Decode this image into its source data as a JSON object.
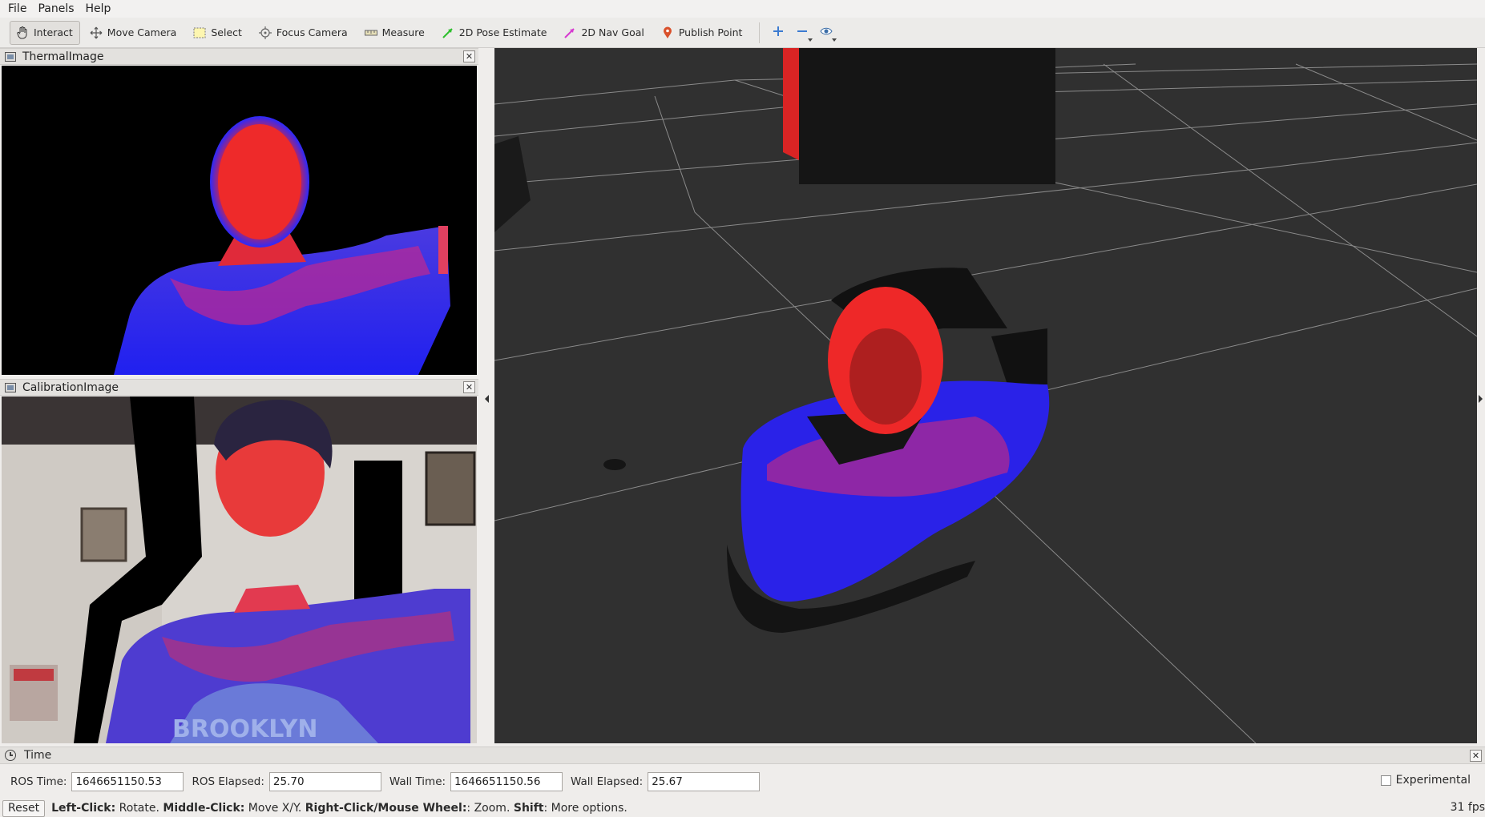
{
  "menubar": {
    "items": [
      {
        "label": "File"
      },
      {
        "label": "Panels"
      },
      {
        "label": "Help"
      }
    ]
  },
  "toolbar": {
    "tools": [
      {
        "label": "Interact",
        "icon": "hand-icon",
        "active": true
      },
      {
        "label": "Move Camera",
        "icon": "move-camera-icon"
      },
      {
        "label": "Select",
        "icon": "select-icon"
      },
      {
        "label": "Focus Camera",
        "icon": "focus-camera-icon"
      },
      {
        "label": "Measure",
        "icon": "ruler-icon"
      },
      {
        "label": "2D Pose Estimate",
        "icon": "green-arrow-icon"
      },
      {
        "label": "2D Nav Goal",
        "icon": "pink-arrow-icon"
      },
      {
        "label": "Publish Point",
        "icon": "map-pin-icon"
      }
    ]
  },
  "panels": {
    "thermal": {
      "title": "ThermalImage"
    },
    "calibration": {
      "title": "CalibrationImage"
    }
  },
  "time_panel": {
    "title": "Time",
    "ros_time_label": "ROS Time:",
    "ros_time_value": "1646651150.53",
    "ros_elapsed_label": "ROS Elapsed:",
    "ros_elapsed_value": "25.70",
    "wall_time_label": "Wall Time:",
    "wall_time_value": "1646651150.56",
    "wall_elapsed_label": "Wall Elapsed:",
    "wall_elapsed_value": "25.67",
    "experimental_label": "Experimental"
  },
  "statusbar": {
    "reset_label": "Reset",
    "help": [
      {
        "key": "Left-Click:",
        "desc": " Rotate. "
      },
      {
        "key": "Middle-Click:",
        "desc": " Move X/Y. "
      },
      {
        "key": "Right-Click/Mouse Wheel:",
        "desc": ": Zoom. "
      },
      {
        "key": "Shift",
        "desc": ": More options."
      }
    ],
    "fps": "31 fps"
  },
  "colors": {
    "view_background": "#303030",
    "grid_line": "#8a8a8a",
    "thermal_hot": "#ff2020",
    "thermal_cold": "#2020ff"
  }
}
